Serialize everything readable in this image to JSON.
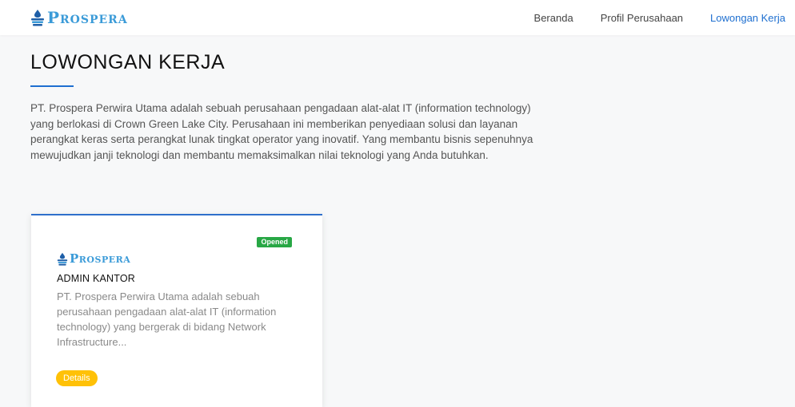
{
  "brand": {
    "name": "Prospera",
    "logo_icon": "droplet-stack-icon",
    "color": "#3b9bd8"
  },
  "nav": {
    "items": [
      {
        "label": "Beranda"
      },
      {
        "label": "Profil Perusahaan"
      },
      {
        "label": "Lowongan Kerja",
        "active": true
      }
    ],
    "active_color": "#1e6fd0"
  },
  "page": {
    "title": "LOWONGAN KERJA",
    "intro": "PT. Prospera Perwira Utama adalah sebuah perusahaan pengadaan alat-alat IT (information technology) yang berlokasi di Crown Green Lake City. Perusahaan ini memberikan penyediaan solusi dan layanan perangkat keras serta perangkat lunak tingkat operator yang inovatif. Yang membantu bisnis sepenuhnya mewujudkan janji teknologi dan membantu memaksimalkan nilai teknologi yang Anda butuhkan."
  },
  "jobs": [
    {
      "status": "Opened",
      "status_color": "#28a745",
      "company_logo": "Prospera",
      "title": "ADMIN KANTOR",
      "description": "PT. Prospera Perwira Utama adalah sebuah perusahaan pengadaan alat-alat IT (information technology) yang bergerak di bidang Network Infrastructure...",
      "button_label": "Details",
      "button_color": "#ffc107"
    }
  ]
}
